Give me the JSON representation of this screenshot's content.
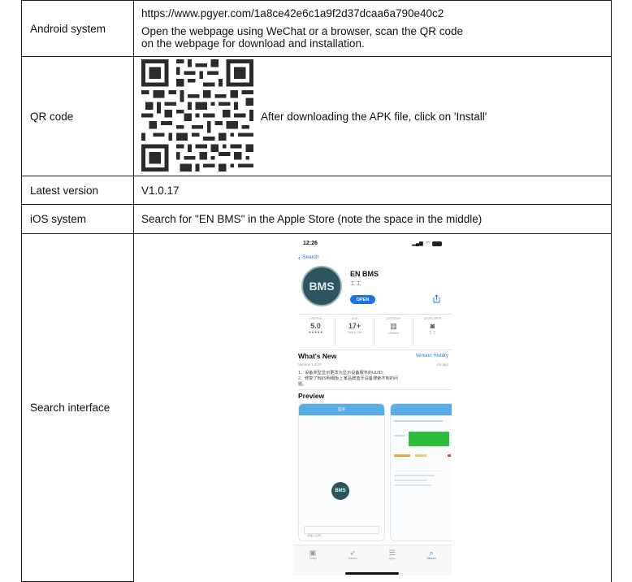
{
  "rows": {
    "android": {
      "label": "Android system",
      "url": "https://www.pgyer.com/1a8ce42e6c1a9f2d37dcaa6a790e40c2",
      "instr_line1": "Open the webpage using WeChat or a browser, scan the QR code",
      "instr_line2": "on the webpage for download and installation."
    },
    "qr": {
      "label": "QR code",
      "text": "After downloading the APK file, click on 'Install'"
    },
    "latest": {
      "label": "Latest version",
      "value": "V1.0.17"
    },
    "ios": {
      "label": "iOS system",
      "value": "Search for \"EN BMS\" in the Apple Store (note the space in the middle)"
    },
    "search": {
      "label": "Search interface"
    }
  },
  "phone": {
    "time": "12:26",
    "back": "Search",
    "app_name": "EN BMS",
    "app_sub": "工 工",
    "logo_text": "BMS",
    "open_button": "OPEN",
    "stats": [
      {
        "label": "1 RATING",
        "value": "5.0",
        "sub": "★★★★★"
      },
      {
        "label": "AGE",
        "value": "17+",
        "sub": "Years Old"
      },
      {
        "label": "CATEGORY",
        "value": "▥",
        "sub": "Utilities"
      },
      {
        "label": "DEVELOPER",
        "value": "◙",
        "sub": "工 工"
      }
    ],
    "whats_new": "What's New",
    "version_history": "Version History",
    "version_small": "Version 1.0.27",
    "ago": "6d ago",
    "note1": "1、设备类型显示更改为显示设备服务的UUID;",
    "note2": "2、修复了BMS明细板上某品牌蓝牙设备搜索不到的问",
    "note3": "题。",
    "preview": "Preview",
    "pv_title": "蓝牙",
    "pv_input": "请输入名称",
    "tabs": [
      "Today",
      "Games",
      "Apps",
      "Search"
    ]
  },
  "colors": {
    "accent": "#1a73e8",
    "logo": "#2d5560",
    "green": "#2fbf3a"
  }
}
